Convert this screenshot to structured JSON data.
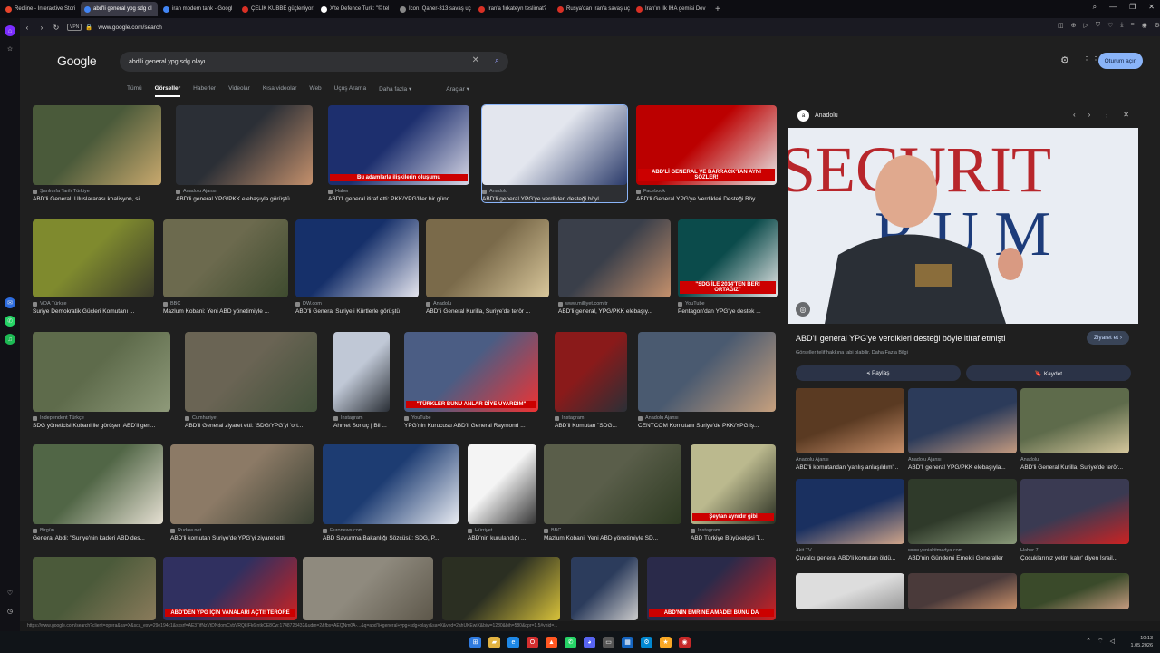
{
  "browser": {
    "tabs": [
      {
        "title": "Redline - Interactive Stori",
        "color": "#e8452c"
      },
      {
        "title": "abd'li general ypg sdg ol",
        "color": "#4285f4",
        "active": true
      },
      {
        "title": "iran modern tank - Googl",
        "color": "#4285f4"
      },
      {
        "title": "ÇELİK KUBBE güçleniyor!",
        "color": "#d93025"
      },
      {
        "title": "X'te Defence Turk: \"© tel",
        "color": "#ffffff"
      },
      {
        "title": "Icon, Qaher-313 savaş uç",
        "color": "#888888"
      },
      {
        "title": "İran'a fırkateyn teslimat?",
        "color": "#d93025"
      },
      {
        "title": "Rusya'dan İran'a savaş uç",
        "color": "#d93025"
      },
      {
        "title": "İran'ın ilk İHA gemisi Dev",
        "color": "#d93025"
      }
    ],
    "new_tab": "+",
    "url": "www.google.com/search",
    "vpn": "VPN",
    "status_url": "https://www.google.com/search?client=opera&ka=X&sca_esv=29e194c1&sxsrf=AE3TifNzVtDNdomCvbVRQkIFk6IntkCE8Cw:1748723432&udm=2&fbs=AEQNm0A-...&q=abd'li+general+ypg+sdg+olayı&sa=X&ved=2ahUKEwiX&biw=1280&bih=580&dpr=1.5#vhid=..."
  },
  "google": {
    "logo": "Google",
    "query": "abd'li general ypg sdg olayı",
    "signin": "Oturum açın",
    "tabs": [
      "Tümü",
      "Görseller",
      "Haberler",
      "Videolar",
      "Kısa videolar",
      "Web",
      "Uçuş Arama",
      "Daha fazla ▾"
    ],
    "tools": "Araçlar ▾"
  },
  "results": [
    {
      "src": "Şanlıurfa Tarih Türkiye",
      "cap": "ABD'li General: Uluslararası koalisyon, si..."
    },
    {
      "src": "Anadolu Ajansı",
      "cap": "ABD'li general YPG/PKK elebaşıyla görüştü"
    },
    {
      "src": "Haber",
      "cap": "ABD'li general itiraf etti: PKK/YPG'liler bir günd...",
      "overlay": "Bu adamlarla ilişkilerin oluşumu"
    },
    {
      "src": "Anadolu",
      "cap": "ABD'li general YPG'ye verdikleri desteği böyl...",
      "sel": true
    },
    {
      "src": "Facebook",
      "cap": "ABD'li General YPG'ye Verdikleri Desteği Böy...",
      "overlay": "ABD'Lİ GENERAL VE BARRACK'TAN AYNI SÖZLER!"
    },
    {
      "src": "VOA Türkçe",
      "cap": "Suriye Demokratik Güçleri Komutanı ..."
    },
    {
      "src": "BBC",
      "cap": "Mazlum Kobani: Yeni ABD yönetimiyle ..."
    },
    {
      "src": "DW.com",
      "cap": "ABD'li General Suriyeli Kürtlerle görüştü"
    },
    {
      "src": "Anadolu",
      "cap": "ABD'li General Kurilla, Suriye'de terör ..."
    },
    {
      "src": "www.milliyet.com.tr",
      "cap": "ABD'li general, YPG/PKK elebaşıy..."
    },
    {
      "src": "YouTube",
      "cap": "Pentagon'dan YPG'ye destek ...",
      "overlay": "\"SDG İLE 2014'TEN BERİ ORTAĞIZ\""
    },
    {
      "src": "Independent Türkçe",
      "cap": "SDG yöneticisi Kobani ile görüşen ABD'li gen..."
    },
    {
      "src": "Cumhuriyet",
      "cap": "ABD'li General ziyaret etti: 'SDG/YPG'yi 'ort..."
    },
    {
      "src": "Instagram",
      "cap": "Ahmet Sonuç | Bil ..."
    },
    {
      "src": "YouTube",
      "cap": "YPG'nin Kurucusu ABD'li General Raymond ...",
      "overlay": "\"TÜRKLER BUNU ANLAR DİYE UYARDIM\""
    },
    {
      "src": "Instagram",
      "cap": "ABD'li Komutan \"SDG..."
    },
    {
      "src": "Anadolu Ajansı",
      "cap": "CENTCOM Komutanı Suriye'de PKK/YPG iş..."
    },
    {
      "src": "Birgün",
      "cap": "General Abdi: \"Suriye'nin kaderi ABD des..."
    },
    {
      "src": "Rudaw.net",
      "cap": "ABD'li komutan Suriye'de YPG'yi ziyaret etti"
    },
    {
      "src": "Euronews.com",
      "cap": "ABD Savunma Bakanlığı Sözcüsü: SDG, P..."
    },
    {
      "src": "Hürriyet",
      "cap": "ABD'nin kurulandığı ..."
    },
    {
      "src": "BBC",
      "cap": "Mazlum Kobani: Yeni ABD yönetimiyle SD..."
    },
    {
      "src": "Instagram",
      "cap": "ABD Türkiye Büyükelçisi T...",
      "overlay": "Şeytan aynıdır gibi"
    },
    {
      "src": "",
      "cap": ""
    },
    {
      "src": "",
      "cap": "",
      "overlay": "ABD'DEN YPG İÇİN VANALARI AÇTI! TERÖRE"
    },
    {
      "src": "",
      "cap": ""
    },
    {
      "src": "",
      "cap": ""
    },
    {
      "src": "",
      "cap": ""
    },
    {
      "src": "",
      "cap": "",
      "overlay": "ABD'NİN EMRİNE AMADE! BUNU DA"
    }
  ],
  "panel": {
    "source": "Anadolu",
    "title": "ABD'li general YPG'ye verdikleri desteği böyle itiraf etmişti",
    "sub": "Görseller telif hakkına tabi olabilir. Daha Fazla Bilgi",
    "visit": "Ziyaret et ›",
    "share": "⪪ Paylaş",
    "save": "🔖 Kaydet",
    "related": [
      {
        "src": "Anadolu Ajansı",
        "cap": "ABD'li komutandan 'yanlış anlaşıldım'..."
      },
      {
        "src": "Anadolu Ajansı",
        "cap": "ABD'li general YPG/PKK elebaşıyla..."
      },
      {
        "src": "Anadolu",
        "cap": "ABD'li General Kurilla, Suriye'de terör..."
      },
      {
        "src": "Akit TV",
        "cap": "Çuvalcı general ABD'li komutan öldü..."
      },
      {
        "src": "www.yeniakitmedya.com",
        "cap": "ABD'nin Gündemi Emekli Generaller"
      },
      {
        "src": "Haber 7",
        "cap": "Çocuklarınız yetim kalır' diyen İsrail..."
      },
      {
        "src": "",
        "cap": ""
      },
      {
        "src": "",
        "cap": ""
      },
      {
        "src": "",
        "cap": ""
      }
    ]
  },
  "taskbar": {
    "time": "10:13",
    "date": "1.05.2026"
  }
}
